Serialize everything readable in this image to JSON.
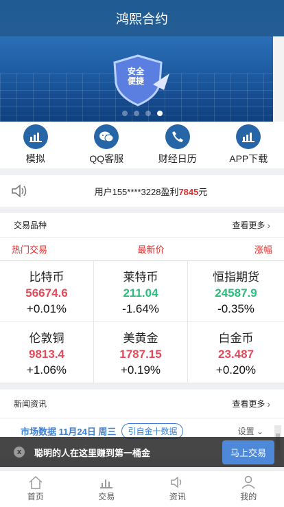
{
  "header": {
    "title": "鸿熙合约"
  },
  "banner": {
    "shield_text_1": "安全",
    "shield_text_2": "便捷",
    "slides": 4,
    "active_slide": 4
  },
  "quick_links": [
    {
      "label": "模拟",
      "icon": "chart-icon"
    },
    {
      "label": "QQ客服",
      "icon": "chat-icon"
    },
    {
      "label": "财经日历",
      "icon": "phone-icon"
    },
    {
      "label": "APP下载",
      "icon": "chart-icon"
    }
  ],
  "notice": {
    "prefix": "用户155****3228盈利",
    "amount": "7845",
    "suffix": "元",
    "icon": "speaker-icon"
  },
  "trading": {
    "title": "交易品种",
    "more": "查看更多",
    "columns": [
      "热门交易",
      "最新价",
      "涨幅"
    ],
    "items": [
      {
        "name": "比特币",
        "price": "56674.6",
        "change": "+0.01%",
        "dir": "up"
      },
      {
        "name": "莱特币",
        "price": "211.04",
        "change": "-1.64%",
        "dir": "down"
      },
      {
        "name": "恒指期货",
        "price": "24587.9",
        "change": "-0.35%",
        "dir": "down"
      },
      {
        "name": "伦敦铜",
        "price": "9813.4",
        "change": "+1.06%",
        "dir": "up"
      },
      {
        "name": "美黄金",
        "price": "1787.15",
        "change": "+0.19%",
        "dir": "up"
      },
      {
        "name": "白金币",
        "price": "23.487",
        "change": "+0.20%",
        "dir": "up"
      }
    ]
  },
  "news": {
    "title": "新闻资讯",
    "more": "查看更多",
    "market_title": "市场数据 11月24日 周三",
    "market_tag": "引自金十数据",
    "settings": "设置"
  },
  "popup": {
    "close": "x",
    "text": "聪明的人在这里赚到第一桶金",
    "button": "马上交易"
  },
  "tabbar": [
    {
      "label": "首页",
      "icon": "home-icon"
    },
    {
      "label": "交易",
      "icon": "chart-icon"
    },
    {
      "label": "资讯",
      "icon": "speaker-icon"
    },
    {
      "label": "我的",
      "icon": "user-icon"
    }
  ]
}
